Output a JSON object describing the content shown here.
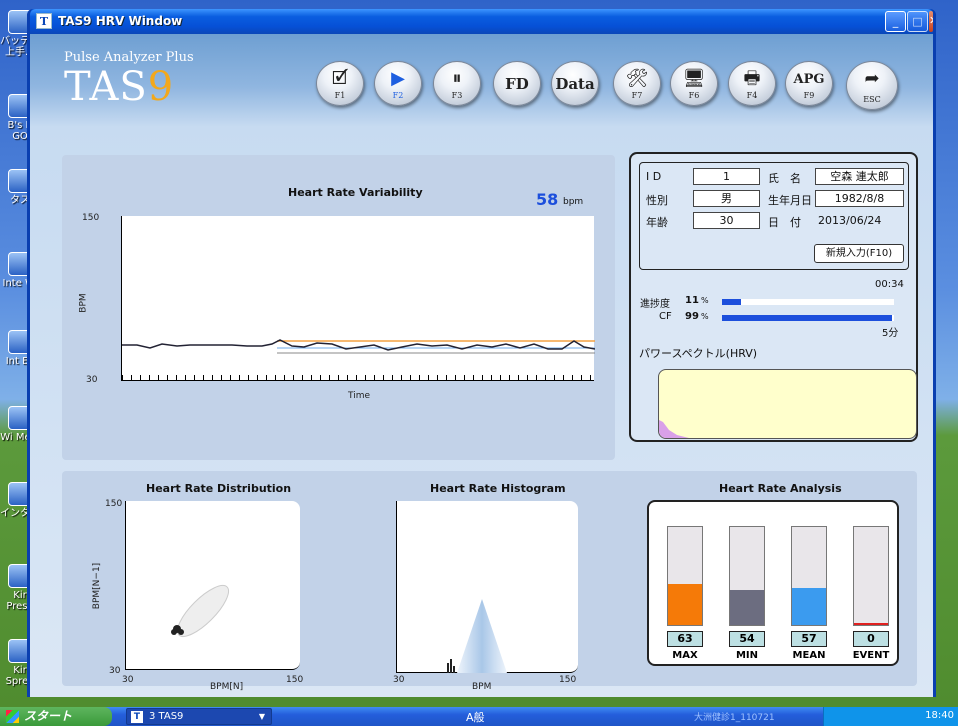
{
  "window": {
    "title": "TAS9 HRV Window",
    "app_icon": "T",
    "minimize": "_",
    "maximize": "□",
    "close": "✕"
  },
  "brand": {
    "subtitle": "Pulse Analyzer Plus",
    "name_main": "TAS",
    "name_num": "9"
  },
  "toolbar": [
    {
      "glyph": "🗹",
      "key": "F1",
      "name": "form-icon"
    },
    {
      "glyph": "▶",
      "key": "F2",
      "name": "play-icon"
    },
    {
      "glyph": "⏸",
      "key": "F3",
      "name": "pause-icon"
    },
    {
      "glyph": "FD",
      "key": "",
      "name": "fd"
    },
    {
      "glyph": "Data",
      "key": "",
      "name": "data"
    },
    {
      "glyph": "🛠",
      "key": "F7",
      "name": "tools-icon"
    },
    {
      "glyph": "🖥",
      "key": "F6",
      "name": "monitor-icon"
    },
    {
      "glyph": "🖶",
      "key": "F4",
      "name": "printer-icon"
    },
    {
      "glyph": "APG",
      "key": "F9",
      "name": "apg"
    },
    {
      "glyph": "➦",
      "key": "ESC",
      "name": "exit-arrow-icon"
    }
  ],
  "hrv": {
    "title": "Heart Rate Variability",
    "bpm_value": "58",
    "bpm_unit": "bpm",
    "ylabel": "BPM",
    "xlabel": "Time",
    "ymax": "150",
    "ymin": "30"
  },
  "patient": {
    "id_label": "I D",
    "id_value": "1",
    "name_label": "氏　名",
    "name_value": "空森 連太郎",
    "sex_label": "性別",
    "sex_value": "男",
    "dob_label": "生年月日",
    "dob_value": "1982/8/8",
    "age_label": "年齢",
    "age_value": "30",
    "date_label": "日　付",
    "date_value": "2013/06/24",
    "new_button": "新規入力(F10)"
  },
  "progress": {
    "time": "00:34",
    "label": "進捗度",
    "value_text": "11",
    "unit": "%",
    "cf_label": "CF",
    "cf_text": "99",
    "cf_unit": "%",
    "duration": "5分",
    "progress_fraction": 0.11,
    "cf_fraction": 0.99
  },
  "spectrum": {
    "title": "パワースペクトル(HRV)"
  },
  "distribution": {
    "title": "Heart Rate Distribution",
    "ylabel": "BPM[N−1]",
    "xlabel": "BPM[N]",
    "ymax": "150",
    "ymin": "30",
    "xmin": "30",
    "xmax": "150"
  },
  "histogram": {
    "title": "Heart Rate Histogram",
    "xlabel": "BPM",
    "xmin": "30",
    "xmax": "150"
  },
  "analysis": {
    "title": "Heart Rate Analysis",
    "items": [
      {
        "label": "MAX",
        "value": "63",
        "fraction": 0.42,
        "color": "#f57a08"
      },
      {
        "label": "MIN",
        "value": "54",
        "fraction": 0.36,
        "color": "#6c6d80"
      },
      {
        "label": "MEAN",
        "value": "57",
        "fraction": 0.38,
        "color": "#3b9bef"
      },
      {
        "label": "EVENT",
        "value": "0",
        "fraction": 0.0,
        "color": "#e02020"
      }
    ]
  },
  "taskbar": {
    "start": "スタート",
    "task": "3 TAS9",
    "task_icon": "T",
    "ime": "A般",
    "notice": "大洲健診1_110721",
    "clock": "18:40"
  },
  "desktop_icons": [
    {
      "label": "バッテリ上手…"
    },
    {
      "label": "B's R GO"
    },
    {
      "label": "タス"
    },
    {
      "label": "Inte Wi"
    },
    {
      "label": "Int Ex"
    },
    {
      "label": "Wi Medi"
    },
    {
      "label": "インタ…"
    },
    {
      "label": "Kir Prese"
    },
    {
      "label": "Kir Sprea"
    }
  ]
}
